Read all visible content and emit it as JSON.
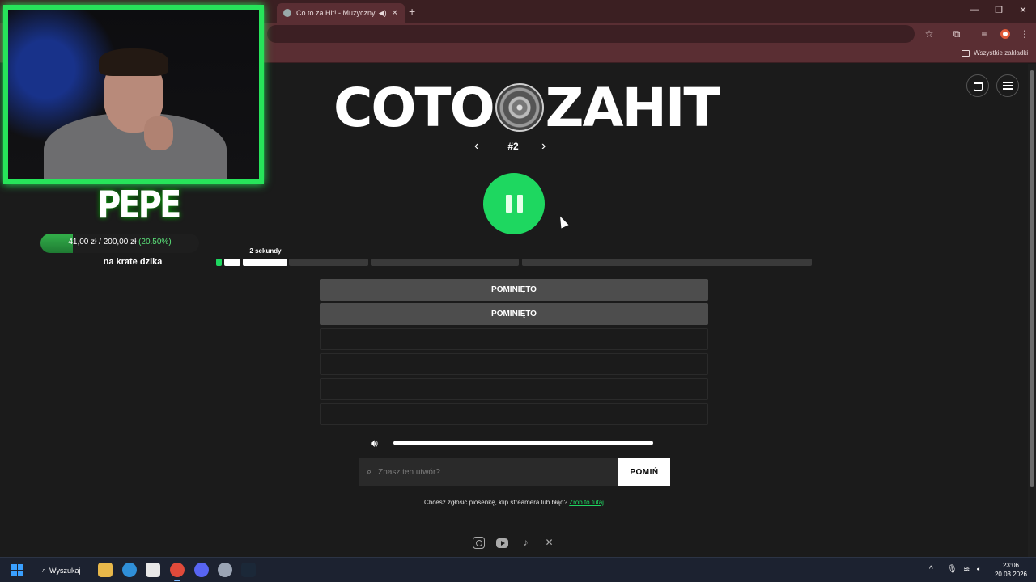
{
  "browser": {
    "inactive_tab_title": "",
    "active_tab_title": "Co to za Hit! - Muzyczny Q",
    "new_tab": "+",
    "bookmarks_folder": "Wszystkie zakładki"
  },
  "site": {
    "logo_left": "COTO",
    "logo_right": "ZAHIT",
    "episode": "#2",
    "prev": "‹",
    "next": "›",
    "segment_label": "2 sekundy",
    "answers": [
      "POMINIĘTO",
      "POMINIĘTO",
      "",
      "",
      "",
      ""
    ],
    "search_placeholder": "Znasz ten utwór?",
    "skip_button": "POMIŃ",
    "report_text": "Chcesz zgłosić piosenkę, klip streamera lub błąd?",
    "report_link": "Zrób to tutaj",
    "volume_level": 1.0,
    "progress_segments_played": 2,
    "progress_segments_total": 6
  },
  "overlay": {
    "streamer_name": "PEPE",
    "donation_current": "41,00 zł",
    "donation_separator": "/",
    "donation_goal": "200,00 zł",
    "donation_percent": "(20.50%)",
    "donation_fraction": 0.205,
    "goal_name": "na krate dzika"
  },
  "taskbar": {
    "search_label": "Wyszukaj",
    "time": "23:06",
    "date": "20.03.2026"
  },
  "colors": {
    "accent_green": "#1ed760",
    "browser_frame": "#5a2e33",
    "page_bg": "#1b1b1b"
  }
}
